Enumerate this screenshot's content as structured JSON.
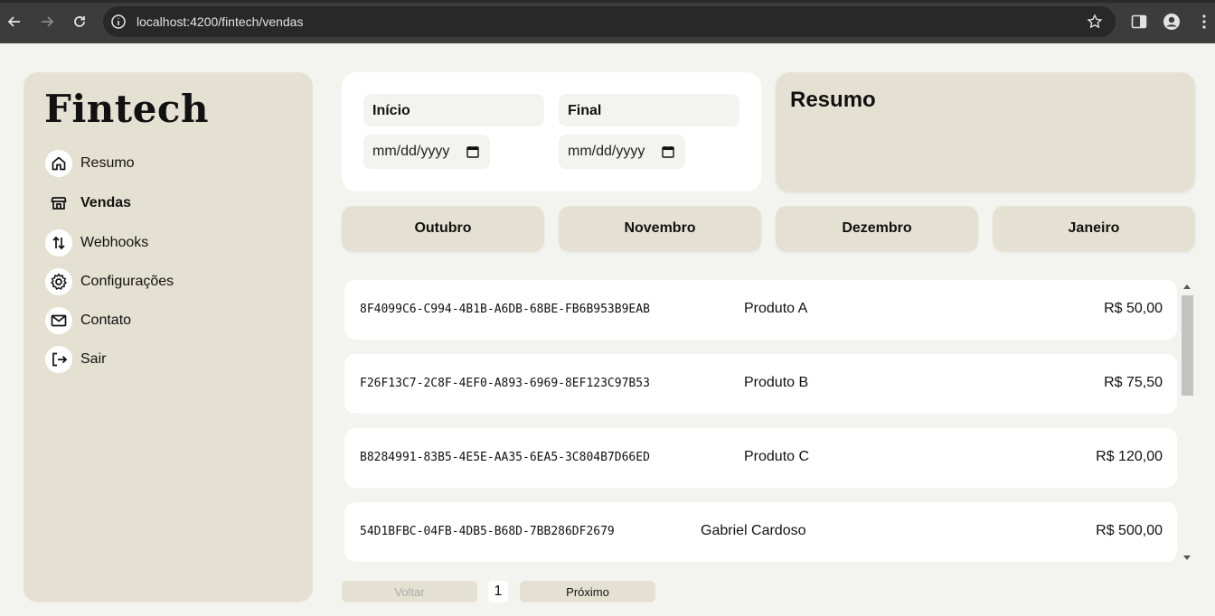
{
  "browser": {
    "url": "localhost:4200/fintech/vendas"
  },
  "sidebar": {
    "logo": "Fintech",
    "items": [
      {
        "label": "Resumo",
        "icon": "home-icon",
        "active": false
      },
      {
        "label": "Vendas",
        "icon": "store-icon",
        "active": true
      },
      {
        "label": "Webhooks",
        "icon": "swap-vertical-icon",
        "active": false
      },
      {
        "label": "Configurações",
        "icon": "gear-icon",
        "active": false
      },
      {
        "label": "Contato",
        "icon": "mail-icon",
        "active": false
      },
      {
        "label": "Sair",
        "icon": "logout-icon",
        "active": false
      }
    ]
  },
  "filters": {
    "start_label": "Início",
    "start_placeholder": "mm/dd/yyyy",
    "end_label": "Final",
    "end_placeholder": "mm/dd/yyyy"
  },
  "summary": {
    "title": "Resumo"
  },
  "months": [
    "Outubro",
    "Novembro",
    "Dezembro",
    "Janeiro"
  ],
  "sales": [
    {
      "id": "8F4099C6-C994-4B1B-A6DB-68BE-FB6B953B9EAB",
      "name": "Produto A",
      "price": "R$ 50,00"
    },
    {
      "id": "F26F13C7-2C8F-4EF0-A893-6969-8EF123C97B53",
      "name": "Produto B",
      "price": "R$ 75,50"
    },
    {
      "id": "B8284991-83B5-4E5E-AA35-6EA5-3C804B7D66ED",
      "name": "Produto C",
      "price": "R$ 120,00"
    },
    {
      "id": "54D1BFBC-04FB-4DB5-B68D-7BB286DF2679",
      "name": "Gabriel Cardoso",
      "price": "R$ 500,00"
    }
  ],
  "pagination": {
    "prev_label": "Voltar",
    "page": "1",
    "next_label": "Próximo"
  },
  "colors": {
    "background": "#f3f3ef",
    "panel": "#e5e1d2",
    "card": "#ffffff"
  }
}
